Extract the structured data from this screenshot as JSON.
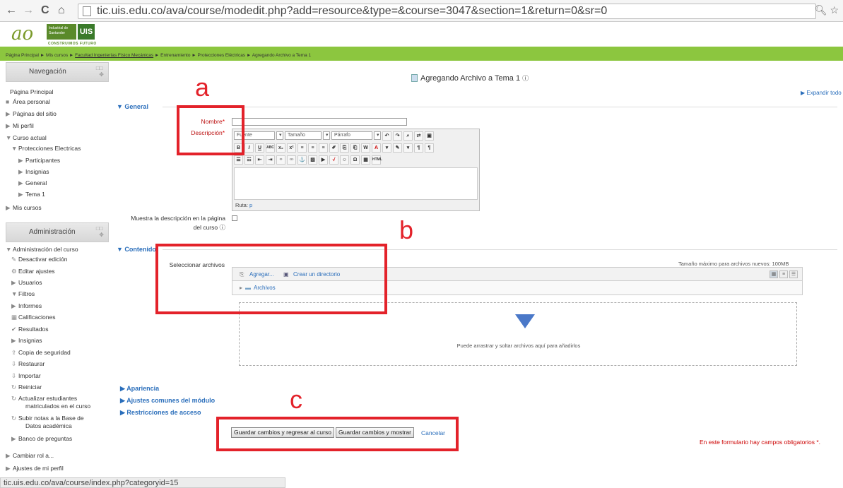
{
  "browser": {
    "url": "tic.uis.edu.co/ava/course/modedit.php?add=resource&type=&course=3047&section=1&return=0&sr=0",
    "back": "←",
    "forward": "→",
    "reload": "C",
    "home": "⌂",
    "status_url": "tic.uis.edu.co/ava/course/index.php?categoryid=15"
  },
  "logo": {
    "mark": "ao",
    "badge_text": "Industrial de Santander",
    "badge_short": "UIS",
    "subtitle": "CONSTRUIMOS FUTURO"
  },
  "breadcrumb": {
    "items": [
      "Página Principal",
      "Mis cursos",
      "Facultad Ingenierías Físico Mecánicas",
      "Entrenamiento",
      "Protecciones Eléctricas",
      "Agregando Archivo a Tema 1"
    ],
    "sep": "►"
  },
  "navigation": {
    "title": "Navegación",
    "items": [
      {
        "label": "Página Principal",
        "prefix": ""
      },
      {
        "label": "Área personal",
        "prefix": "■"
      },
      {
        "label": "Páginas del sitio",
        "prefix": "▶"
      },
      {
        "label": "Mi perfil",
        "prefix": "▶"
      },
      {
        "label": "Curso actual",
        "prefix": "▼"
      },
      {
        "label": "Protecciones Electricas",
        "prefix": "▼"
      },
      {
        "label": "Participantes",
        "prefix": "▶"
      },
      {
        "label": "Insignias",
        "prefix": "▶"
      },
      {
        "label": "General",
        "prefix": "▶"
      },
      {
        "label": "Tema 1",
        "prefix": "▶"
      },
      {
        "label": "Mis cursos",
        "prefix": "▶"
      }
    ]
  },
  "administration": {
    "title": "Administración",
    "items": [
      {
        "label": "Administración del curso",
        "prefix": "▼"
      },
      {
        "label": "Desactivar edición",
        "prefix": "✎"
      },
      {
        "label": "Editar ajustes",
        "prefix": "⚙"
      },
      {
        "label": "Usuarios",
        "prefix": "▶"
      },
      {
        "label": "Filtros",
        "prefix": "▼"
      },
      {
        "label": "Informes",
        "prefix": "▶"
      },
      {
        "label": "Calificaciones",
        "prefix": "▦"
      },
      {
        "label": "Resultados",
        "prefix": "✔"
      },
      {
        "label": "Insignias",
        "prefix": "▶"
      },
      {
        "label": "Copia de seguridad",
        "prefix": "⇪"
      },
      {
        "label": "Restaurar",
        "prefix": "⇩"
      },
      {
        "label": "Importar",
        "prefix": "⇩"
      },
      {
        "label": "Reiniciar",
        "prefix": "↻"
      },
      {
        "label": "Actualizar estudiantes",
        "prefix": "↻"
      },
      {
        "label": "matriculados en el curso",
        "prefix": ""
      },
      {
        "label": "Subir notas a la Base de",
        "prefix": "↻"
      },
      {
        "label": "Datos académica",
        "prefix": ""
      },
      {
        "label": "Banco de preguntas",
        "prefix": "▶"
      },
      {
        "label": "Cambiar rol a...",
        "prefix": "▶"
      },
      {
        "label": "Ajustes de mi perfil",
        "prefix": "▶"
      }
    ]
  },
  "page": {
    "title": "Agregando Archivo a Tema 1",
    "expand_all": "Expandir todo"
  },
  "general_section": {
    "legend": "General",
    "name_label": "Nombre",
    "description_label": "Descripción",
    "show_description_label_1": "Muestra la descripción en la página",
    "show_description_label_2": "del curso",
    "editor": {
      "font_select": "Fuente",
      "size_select": "Tamaño",
      "format_select": "Párrafo",
      "path_label": "Ruta:",
      "path_value": "p"
    }
  },
  "content_section": {
    "legend": "Contenido",
    "select_files_label": "Seleccionar archivos",
    "max_size": "Tamaño máximo para archivos nuevos: 100MB",
    "add_label": "Agregar...",
    "create_dir_label": "Crear un directorio",
    "folder_label": "Archivos",
    "drop_text": "Puede arrastrar y soltar archivos aquí para añadirlos"
  },
  "collapsed_sections": [
    "Apariencia",
    "Ajustes comunes del módulo",
    "Restricciones de acceso"
  ],
  "actions": {
    "save_return": "Guardar cambios y regresar al curso",
    "save_display": "Guardar cambios y mostrar",
    "cancel": "Cancelar",
    "required_note": "En este formulario hay campos obligatorios",
    "required_star": "*."
  },
  "annotations": {
    "a": "a",
    "b": "b",
    "c": "c",
    "color": "#e3222a"
  }
}
